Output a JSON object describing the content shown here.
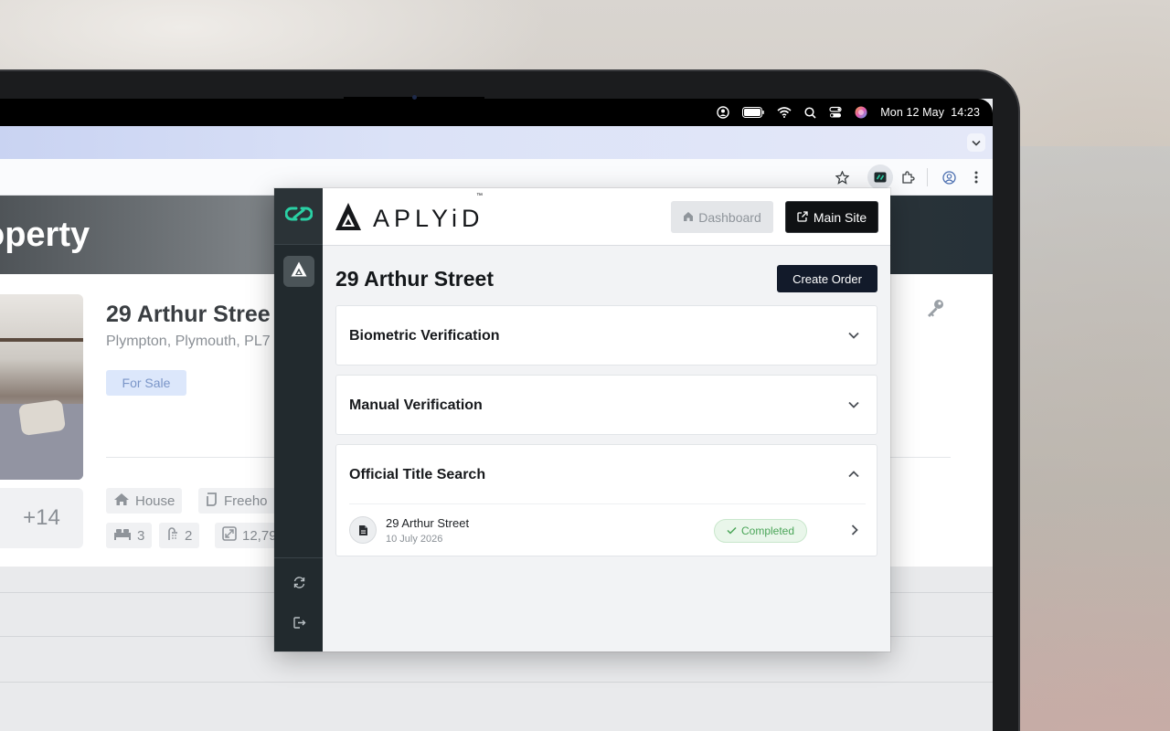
{
  "menubar": {
    "date": "Mon 12 May",
    "time": "14:23",
    "icons": [
      "user-icon",
      "battery-icon",
      "wifi-icon",
      "spotlight-search-icon",
      "control-center-icon",
      "siri-icon"
    ]
  },
  "browser": {
    "toolbar_icons": [
      "bookmark-star-icon",
      "aplyid-extension-icon",
      "extensions-puzzle-icon",
      "profile-icon",
      "more-menu-icon"
    ]
  },
  "website": {
    "banner_title": "operty",
    "property_title": "29 Arthur Stree",
    "property_address": "Plympton, Plymouth, PL7",
    "status_badge": "For Sale",
    "more_photos": "+14",
    "chips": {
      "type": "House",
      "tenure": "Freeho",
      "bedrooms": "3",
      "bathrooms": "2",
      "area": "12,79"
    }
  },
  "extension": {
    "logo_text": "APLYiD",
    "logo_tm": "™",
    "dashboard_label": "Dashboard",
    "main_site_label": "Main Site",
    "property_title": "29 Arthur Street",
    "create_order_label": "Create Order",
    "sections": [
      {
        "label": "Biometric Verification",
        "expanded": false
      },
      {
        "label": "Manual Verification",
        "expanded": false
      },
      {
        "label": "Official Title Search",
        "expanded": true,
        "items": [
          {
            "title": "29 Arthur Street",
            "date": "10 July 2026",
            "status": "Completed"
          }
        ]
      }
    ],
    "colors": {
      "rail": "#222a2e",
      "brand_accent": "#2ad0a4",
      "status_success": "#4aa558",
      "primary_dark": "#121a2a"
    }
  }
}
